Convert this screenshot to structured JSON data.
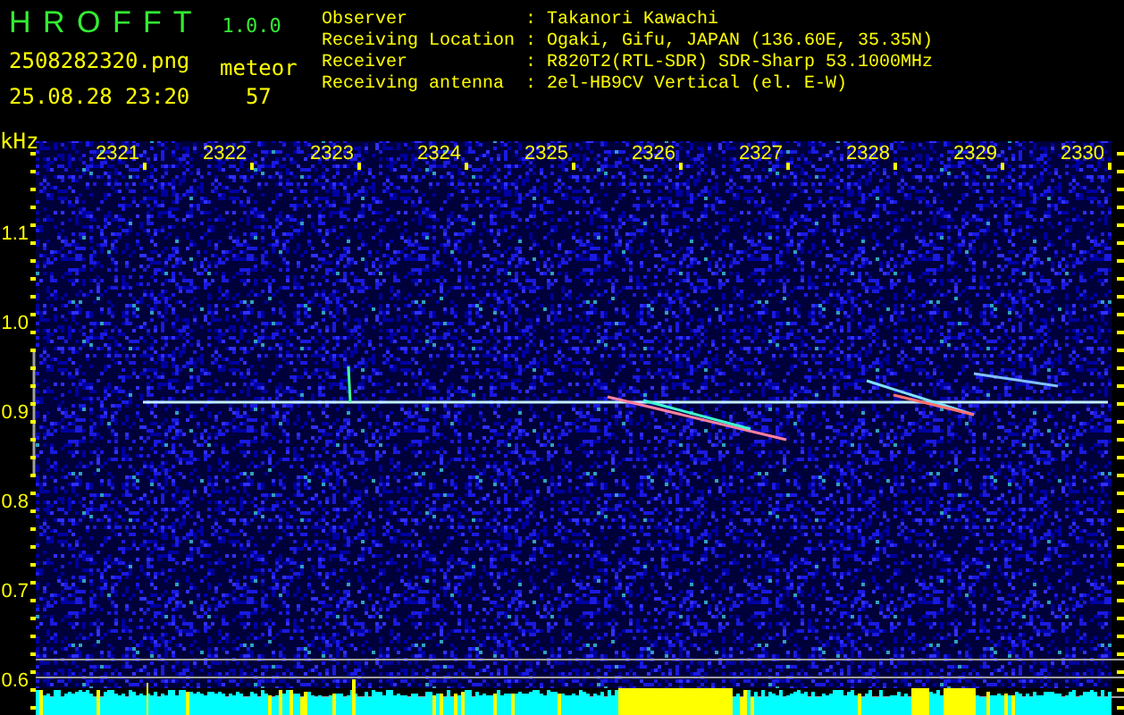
{
  "app": {
    "title": "H R O F F T",
    "version": "1.0.0"
  },
  "file": {
    "name": "2508282320.png",
    "datetime": "25.08.28 23:20"
  },
  "meteor": {
    "label": "meteor",
    "count": "57"
  },
  "station": [
    {
      "label": "Observer",
      "sep": ":",
      "value": "Takanori Kawachi"
    },
    {
      "label": "Receiving Location",
      "sep": ":",
      "value": "Ogaki, Gifu, JAPAN (136.60E, 35.35N)"
    },
    {
      "label": "Receiver",
      "sep": ":",
      "value": "R820T2(RTL-SDR) SDR-Sharp 53.1000MHz"
    },
    {
      "label": "Receiving antenna",
      "sep": ":",
      "value": "2el-HB9CV Vertical (el. E-W)"
    }
  ],
  "spectrogram": {
    "y_unit": "kHz",
    "x_ticks": [
      "2321",
      "2322",
      "2323",
      "2324",
      "2325",
      "2326",
      "2327",
      "2328",
      "2329",
      "2330"
    ],
    "y_ticks": [
      "1.1",
      "1.0",
      "0.9",
      "0.8",
      "0.7",
      "0.6"
    ]
  }
}
